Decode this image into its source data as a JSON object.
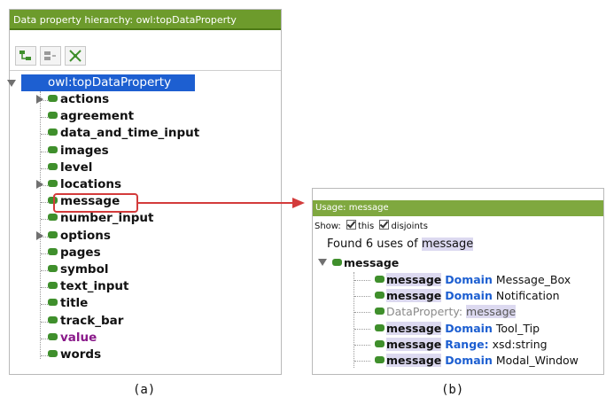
{
  "panel_a": {
    "title": "Data property hierarchy: owl:topDataProperty",
    "root_label": "owl:topDataProperty",
    "items": [
      {
        "label": "actions",
        "expandable": true
      },
      {
        "label": "agreement",
        "expandable": false
      },
      {
        "label": "data_and_time_input",
        "expandable": false
      },
      {
        "label": "images",
        "expandable": false
      },
      {
        "label": "level",
        "expandable": false
      },
      {
        "label": "locations",
        "expandable": true
      },
      {
        "label": "message",
        "expandable": false
      },
      {
        "label": "number_input",
        "expandable": false
      },
      {
        "label": "options",
        "expandable": true
      },
      {
        "label": "pages",
        "expandable": false
      },
      {
        "label": "symbol",
        "expandable": false
      },
      {
        "label": "text_input",
        "expandable": false
      },
      {
        "label": "title",
        "expandable": false
      },
      {
        "label": "track_bar",
        "expandable": false
      },
      {
        "label": "value",
        "expandable": false
      },
      {
        "label": "words",
        "expandable": false
      }
    ],
    "toolbar_icons": [
      "add-subproperty-icon",
      "add-sibling-icon",
      "delete-property-icon"
    ]
  },
  "panel_b": {
    "title": "Usage: message",
    "show_label": "Show:",
    "this_label": "this",
    "disjoints_label": "disjoints",
    "found_prefix": "Found 6 uses of",
    "found_term": "message",
    "root_label": "message",
    "uses": [
      {
        "subject": "message",
        "keyword": "Domain",
        "object": "Message_Box"
      },
      {
        "subject": "message",
        "keyword": "Domain",
        "object": "Notification"
      },
      {
        "subject": "DataProperty:",
        "keyword": "",
        "object": "message"
      },
      {
        "subject": "message",
        "keyword": "Domain",
        "object": "Tool_Tip"
      },
      {
        "subject": "message",
        "keyword": "Range:",
        "object": "xsd:string"
      },
      {
        "subject": "message",
        "keyword": "Domain",
        "object": "Modal_Window"
      }
    ]
  },
  "captions": {
    "a": "(a)",
    "b": "(b)"
  },
  "colors": {
    "titlebar_green": "#6d9b2c",
    "selection_blue": "#1d5fd1",
    "property_dot": "#3f8f2c",
    "highlight_red": "#d33b3b",
    "value_purple": "#8a1a8a"
  }
}
